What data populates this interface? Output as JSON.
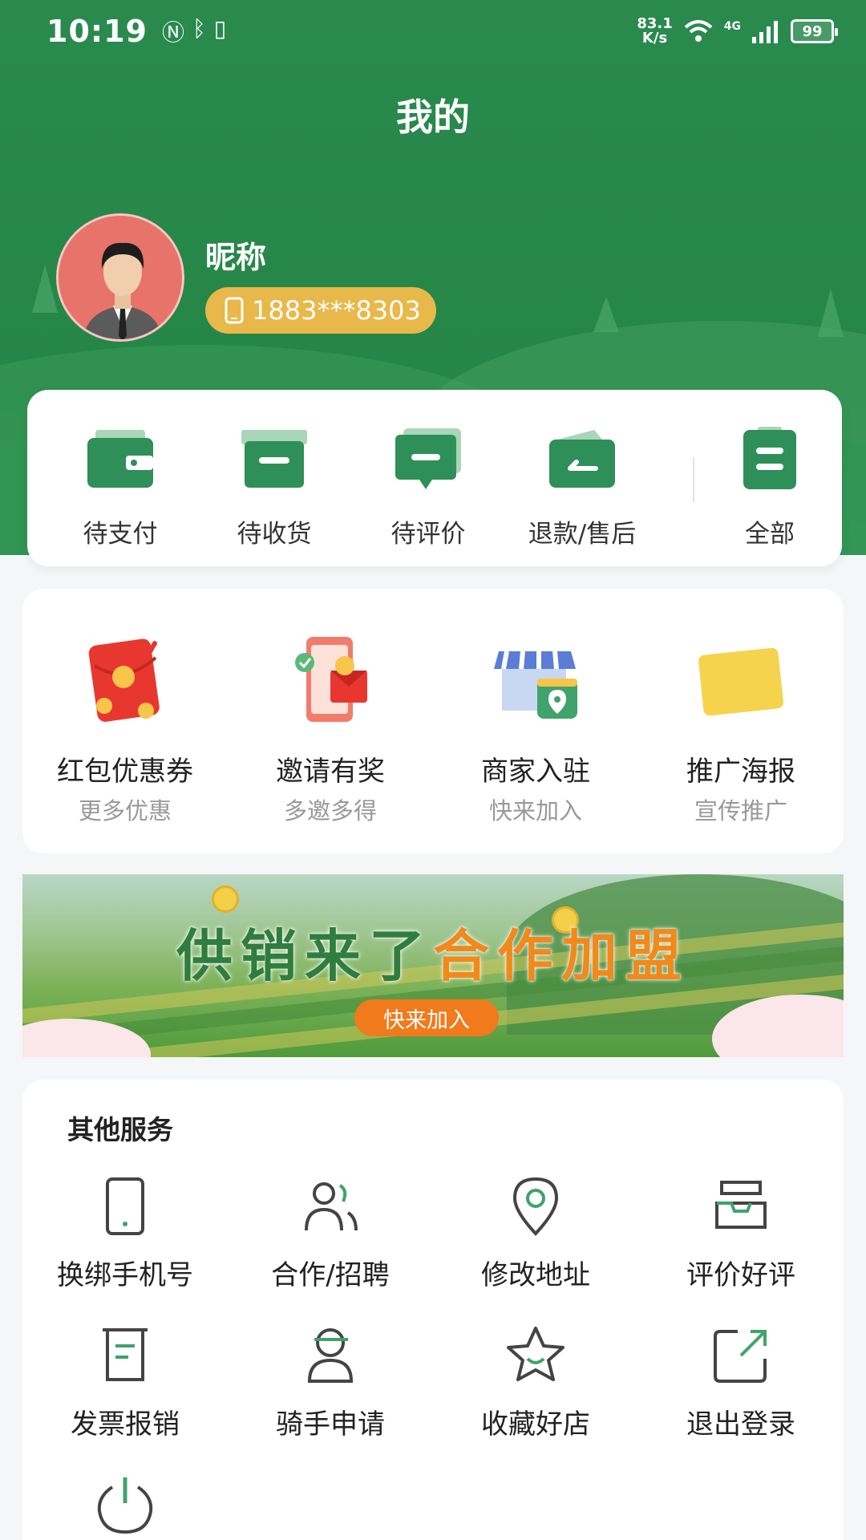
{
  "status_bar": {
    "time": "10:19",
    "net_speed_value": "83.1",
    "net_speed_unit": "K/s",
    "network": "4G",
    "battery": "99"
  },
  "page": {
    "title": "我的"
  },
  "profile": {
    "nickname": "昵称",
    "phone": "1883***8303"
  },
  "orders": [
    {
      "label": "待支付",
      "icon": "wallet-icon"
    },
    {
      "label": "待收货",
      "icon": "box-icon"
    },
    {
      "label": "待评价",
      "icon": "comment-icon"
    },
    {
      "label": "退款/售后",
      "icon": "refund-icon"
    },
    {
      "label": "全部",
      "icon": "clipboard-icon"
    }
  ],
  "promos": [
    {
      "title": "红包优惠券",
      "subtitle": "更多优惠",
      "icon": "red-packet-icon"
    },
    {
      "title": "邀请有奖",
      "subtitle": "多邀多得",
      "icon": "invite-gift-icon"
    },
    {
      "title": "商家入驻",
      "subtitle": "快来加入",
      "icon": "store-icon"
    },
    {
      "title": "推广海报",
      "subtitle": "宣传推广",
      "icon": "poster-icon"
    }
  ],
  "banner": {
    "title_part1": "供销来了",
    "title_part2": "合作加盟",
    "button": "快来加入"
  },
  "services": {
    "title": "其他服务",
    "items": [
      {
        "label": "换绑手机号",
        "icon": "phone-icon"
      },
      {
        "label": "合作/招聘",
        "icon": "people-icon"
      },
      {
        "label": "修改地址",
        "icon": "location-pin-icon"
      },
      {
        "label": "评价好评",
        "icon": "tray-icon"
      },
      {
        "label": "发票报销",
        "icon": "invoice-icon"
      },
      {
        "label": "骑手申请",
        "icon": "rider-icon"
      },
      {
        "label": "收藏好店",
        "icon": "star-icon"
      },
      {
        "label": "退出登录",
        "icon": "logout-icon"
      },
      {
        "label": "",
        "icon": "power-icon"
      }
    ]
  },
  "colors": {
    "brand_green": "#248647",
    "icon_green": "#2f8f58",
    "phone_pill": "#e8b84a",
    "banner_button": "#f07a1c"
  }
}
